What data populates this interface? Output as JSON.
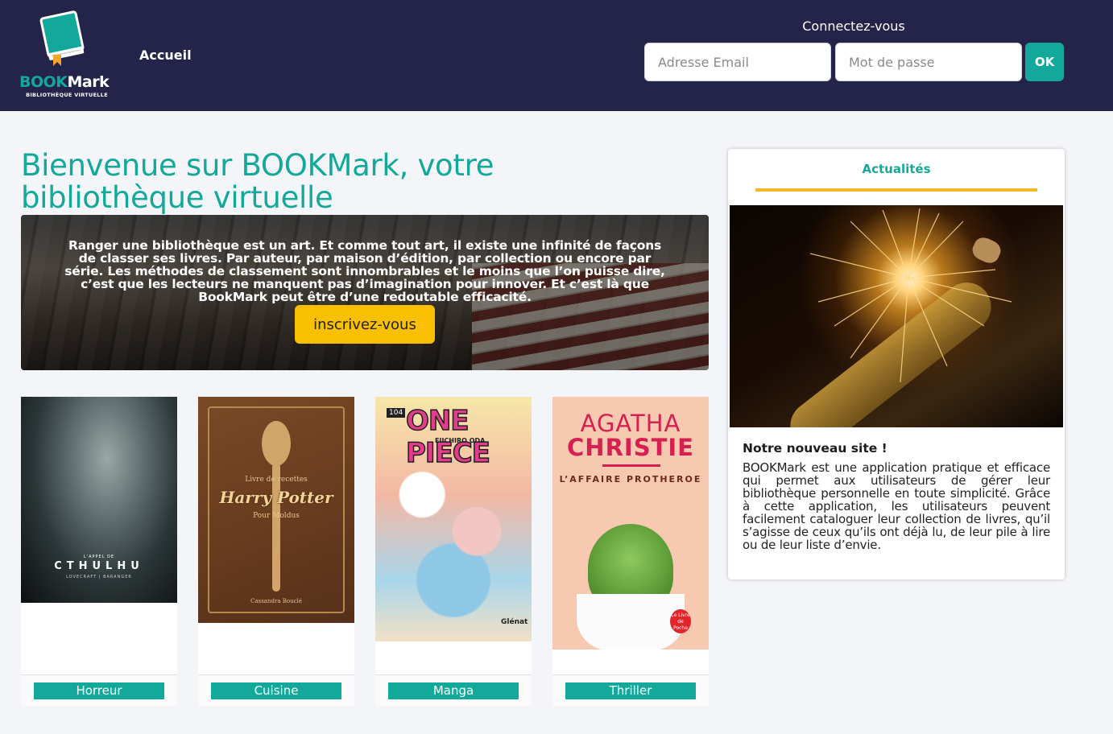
{
  "logo": {
    "word_part1": "BOOK",
    "word_part2": "Mark",
    "tagline": "BIBLIOTHÈQUE VIRTUELLE"
  },
  "nav": {
    "home_label": "Accueil"
  },
  "login": {
    "title": "Connectez-vous",
    "email_placeholder": "Adresse Email",
    "password_placeholder": "Mot de passe",
    "submit_label": "OK"
  },
  "main": {
    "title": "Bienvenue sur BOOKMark, votre bibliothèque virtuelle",
    "hero_text": "Ranger une bibliothèque est un art. Et comme tout art, il existe une infinité de façons de classer ses livres. Par auteur, par maison d’édition, par collection ou encore par série. Les méthodes de classement sont innombrables et le moins que l’on puisse dire, c’est que les lecteurs ne manquent pas d’imagination pour innover. Et c’est là que BookMark peut être d’une redoutable efficacité.",
    "hero_button": "inscrivez-vous"
  },
  "books": [
    {
      "genre": "Horreur",
      "cover": {
        "line1": "L'APPEL DE",
        "title": "CTHULHU",
        "line3": "LOVECRAFT | BARANGER"
      }
    },
    {
      "genre": "Cuisine",
      "cover": {
        "line1": "Livre de recettes",
        "title": "Harry Potter",
        "line3": "Pour Moldus",
        "author": "Cassandra Bouclé"
      }
    },
    {
      "genre": "Manga",
      "cover": {
        "vol": "104",
        "title": "ONE PIECE",
        "author": "EIICHIRO ODA",
        "publisher": "Glénat"
      }
    },
    {
      "genre": "Thriller",
      "cover": {
        "author_first": "AGATHA",
        "author_last": "CHRISTIE",
        "title": "L’AFFAIRE PROTHEROE",
        "collection": "Le Livre de Poche"
      }
    }
  ],
  "news": {
    "tab_label": "Actualités",
    "title": "Notre nouveau site !",
    "body": "BOOKMark est une application pratique et efficace qui permet aux utilisateurs de gérer leur bibliothèque personnelle en toute simplicité. Grâce à cette application, les utilisateurs peuvent facilement cataloguer leur collection de livres, qu’il s’agisse de ceux qu’ils ont déjà lu, de leur pile à lire ou de leur liste d’envie."
  },
  "colors": {
    "header_bg": "#24244a",
    "accent_teal": "#13a99a",
    "accent_yellow": "#f8c000",
    "news_underline": "#f4b92b"
  }
}
